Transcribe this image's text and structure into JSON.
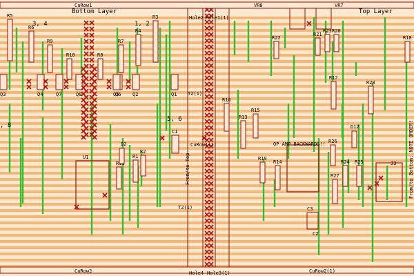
{
  "layers": {
    "bottom": "Bottom Layer",
    "top": "Top Layer"
  },
  "rails": {
    "top_left": "CuRow1",
    "top_right": "VR8",
    "top_vr7": "VR7",
    "bottom_left": "CuRow2",
    "bottom_right": "CuRow2(1)"
  },
  "center_labels": {
    "hole2": "Hole2",
    "hole1": "Hole1(1)",
    "hole4": "Hole4",
    "hole3": "Hole3(1)",
    "curow_mid": "CuRow1(1)",
    "t2_top": "T2(1)",
    "t2_bottom": "T2(1)"
  },
  "notes": {
    "pins_34": "3, 4",
    "pins_12": "1, 2",
    "pins_56": "5, 6",
    "pins_8": ", 8",
    "from_top": "From/to Top",
    "from_bottom": "From/to Bottom: NOTE ORDER!",
    "op_amp": "OP AMP BACKWARDS!!"
  },
  "components": {
    "resistors_left": [
      "R5",
      "R6",
      "R9",
      "R10",
      "R8",
      "R7",
      "R4",
      "R3",
      "R11",
      "R1",
      "R2"
    ],
    "transistors": [
      "Q3",
      "Q4",
      "Q7",
      "Q8",
      "Q6",
      "Q5",
      "Q2",
      "Q1"
    ],
    "other_left": [
      "C1",
      "D2",
      "U1"
    ],
    "resistors_right": [
      "R23",
      "R22",
      "R21",
      "R20",
      "R18",
      "R12",
      "R16",
      "R15",
      "R13",
      "R19",
      "R14",
      "R26",
      "R24",
      "R25",
      "R27",
      "R28"
    ],
    "other_right": [
      "D12",
      "J3",
      "C3",
      "C2"
    ]
  },
  "colors": {
    "board": "#fbe8cf",
    "strip": "#f3b97a",
    "trace": "#2fbf2f",
    "cut": "#b01010",
    "outline": "#9a1010"
  }
}
